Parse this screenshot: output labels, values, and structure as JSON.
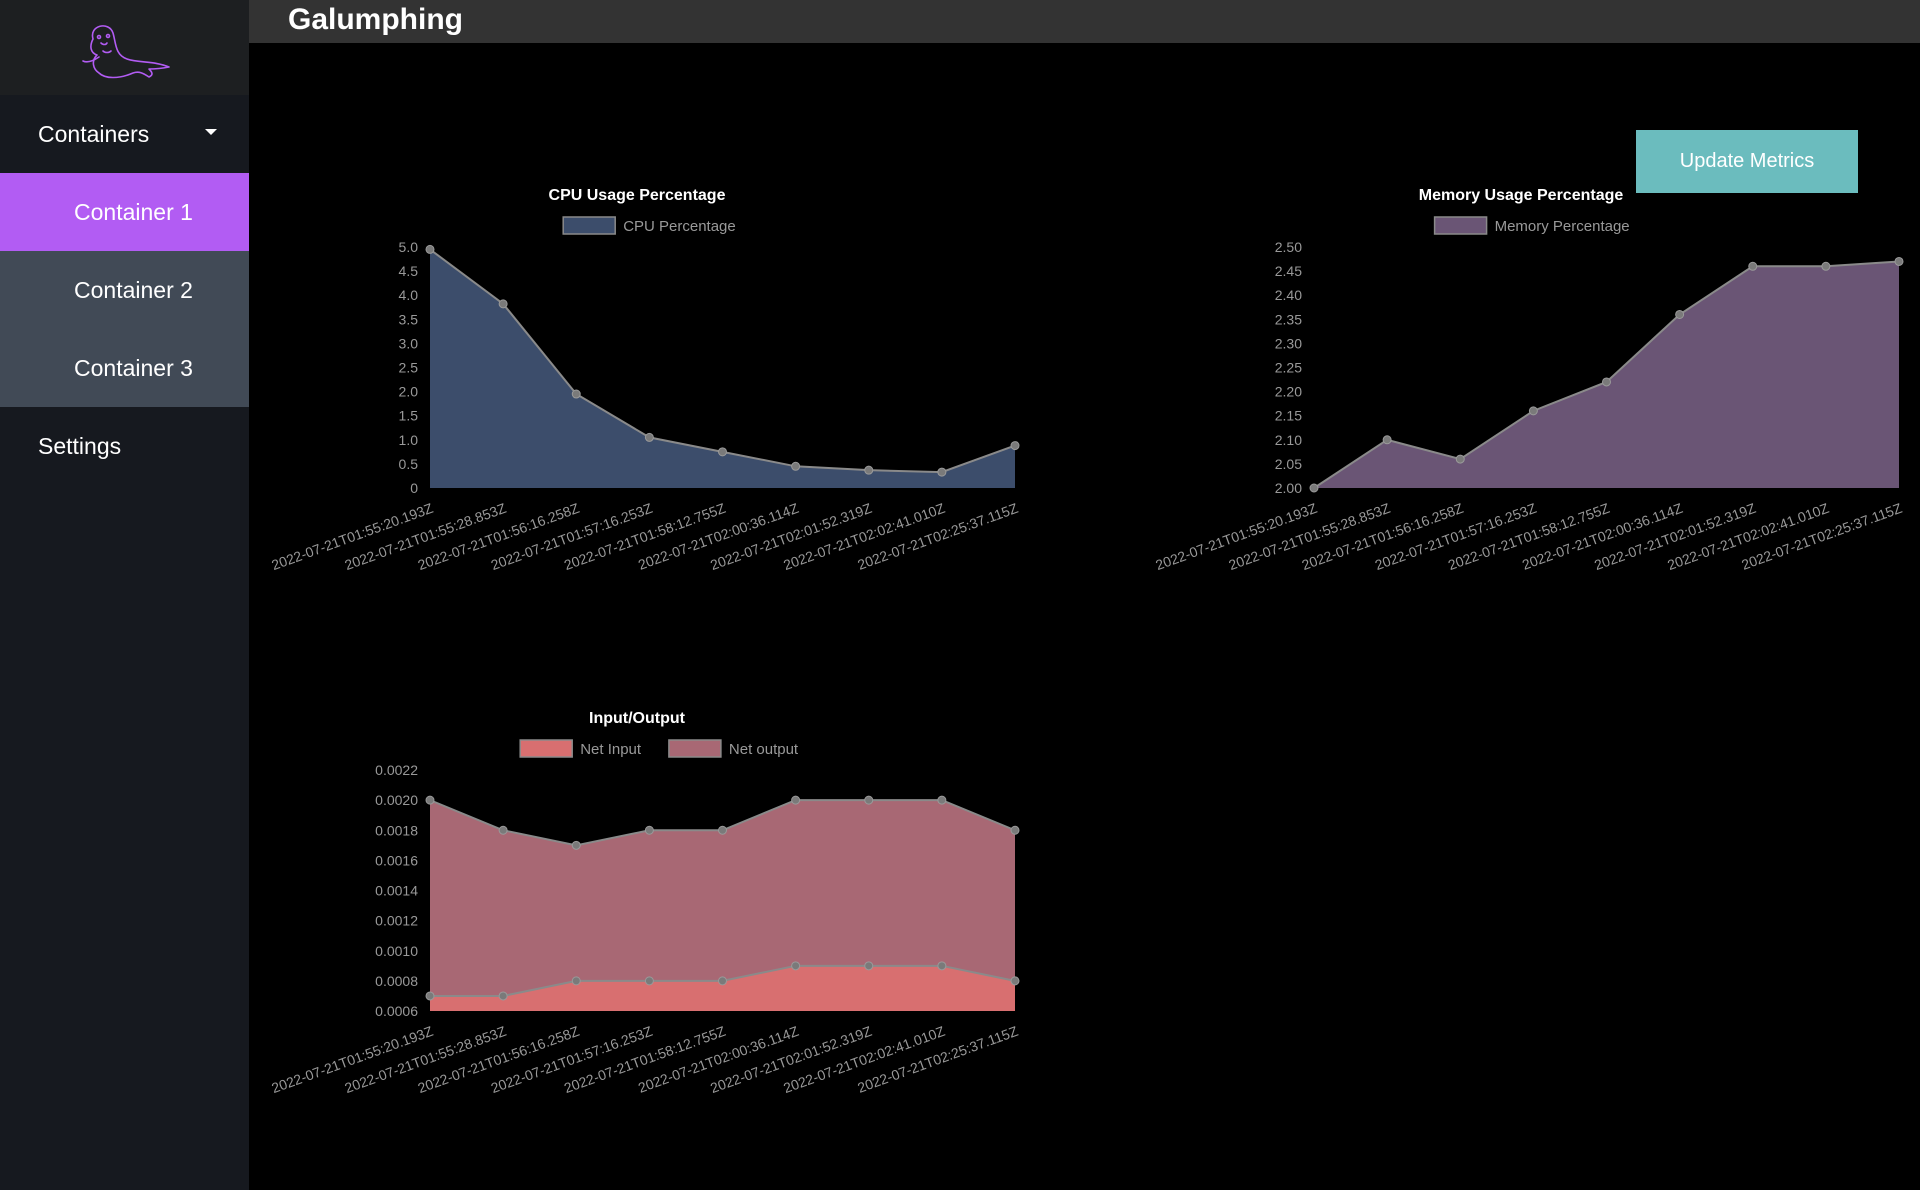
{
  "app": {
    "title": "Galumphing"
  },
  "sidebar": {
    "items": [
      {
        "label": "Containers",
        "icon": "caret-down-icon"
      },
      {
        "label": "Container 1",
        "active": true
      },
      {
        "label": "Container 2"
      },
      {
        "label": "Container 3"
      },
      {
        "label": "Settings"
      }
    ]
  },
  "toolbar": {
    "update_label": "Update Metrics"
  },
  "colors": {
    "sidebar_bg": "#16191f",
    "active_item": "#b25cf3",
    "sub_item_bg": "#414a56",
    "header_bg": "#333333",
    "button_bg": "#6bbcbe",
    "cpu_fill": "#3c4d6b",
    "mem_fill": "#6a5575",
    "net_input_fill": "#d86f70",
    "net_output_fill": "#a86874"
  },
  "chart_data": [
    {
      "type": "area",
      "title": "CPU Usage Percentage",
      "x": [
        "2022-07-21T01:55:20.193Z",
        "2022-07-21T01:55:28.853Z",
        "2022-07-21T01:56:16.258Z",
        "2022-07-21T01:57:16.253Z",
        "2022-07-21T01:58:12.755Z",
        "2022-07-21T02:00:36.114Z",
        "2022-07-21T02:01:52.319Z",
        "2022-07-21T02:02:41.010Z",
        "2022-07-21T02:25:37.115Z"
      ],
      "series": [
        {
          "name": "CPU Percentage",
          "color": "#3c4d6b",
          "values": [
            4.95,
            3.82,
            1.95,
            1.05,
            0.75,
            0.45,
            0.37,
            0.33,
            0.88
          ]
        }
      ],
      "yticks": [
        "5.0",
        "4.5",
        "4.0",
        "3.5",
        "3.0",
        "2.5",
        "2.0",
        "1.5",
        "1.0",
        "0.5",
        "0"
      ],
      "ylim": [
        0,
        5
      ],
      "legend": "top-center"
    },
    {
      "type": "area",
      "title": "Memory Usage Percentage",
      "x": [
        "2022-07-21T01:55:20.193Z",
        "2022-07-21T01:55:28.853Z",
        "2022-07-21T01:56:16.258Z",
        "2022-07-21T01:57:16.253Z",
        "2022-07-21T01:58:12.755Z",
        "2022-07-21T02:00:36.114Z",
        "2022-07-21T02:01:52.319Z",
        "2022-07-21T02:02:41.010Z",
        "2022-07-21T02:25:37.115Z"
      ],
      "series": [
        {
          "name": "Memory Percentage",
          "color": "#6a5575",
          "values": [
            2.0,
            2.1,
            2.06,
            2.16,
            2.22,
            2.36,
            2.46,
            2.46,
            2.47
          ]
        }
      ],
      "yticks": [
        "2.50",
        "2.45",
        "2.40",
        "2.35",
        "2.30",
        "2.25",
        "2.20",
        "2.15",
        "2.10",
        "2.05",
        "2.00"
      ],
      "ylim": [
        2.0,
        2.5
      ],
      "legend": "top-center"
    },
    {
      "type": "area",
      "title": "Input/Output",
      "x": [
        "2022-07-21T01:55:20.193Z",
        "2022-07-21T01:55:28.853Z",
        "2022-07-21T01:56:16.258Z",
        "2022-07-21T01:57:16.253Z",
        "2022-07-21T01:58:12.755Z",
        "2022-07-21T02:00:36.114Z",
        "2022-07-21T02:01:52.319Z",
        "2022-07-21T02:02:41.010Z",
        "2022-07-21T02:25:37.115Z"
      ],
      "series": [
        {
          "name": "Net Input",
          "color": "#d86f70",
          "values": [
            0.0007,
            0.0007,
            0.0008,
            0.0008,
            0.0008,
            0.0009,
            0.0009,
            0.0009,
            0.0008
          ]
        },
        {
          "name": "Net output",
          "color": "#a86874",
          "values": [
            0.002,
            0.0018,
            0.0017,
            0.0018,
            0.0018,
            0.002,
            0.002,
            0.002,
            0.0018
          ]
        }
      ],
      "yticks": [
        "0.0022",
        "0.0020",
        "0.0018",
        "0.0016",
        "0.0014",
        "0.0012",
        "0.0010",
        "0.0008",
        "0.0006"
      ],
      "ylim": [
        0.0006,
        0.0022
      ],
      "legend": "top-center"
    }
  ]
}
